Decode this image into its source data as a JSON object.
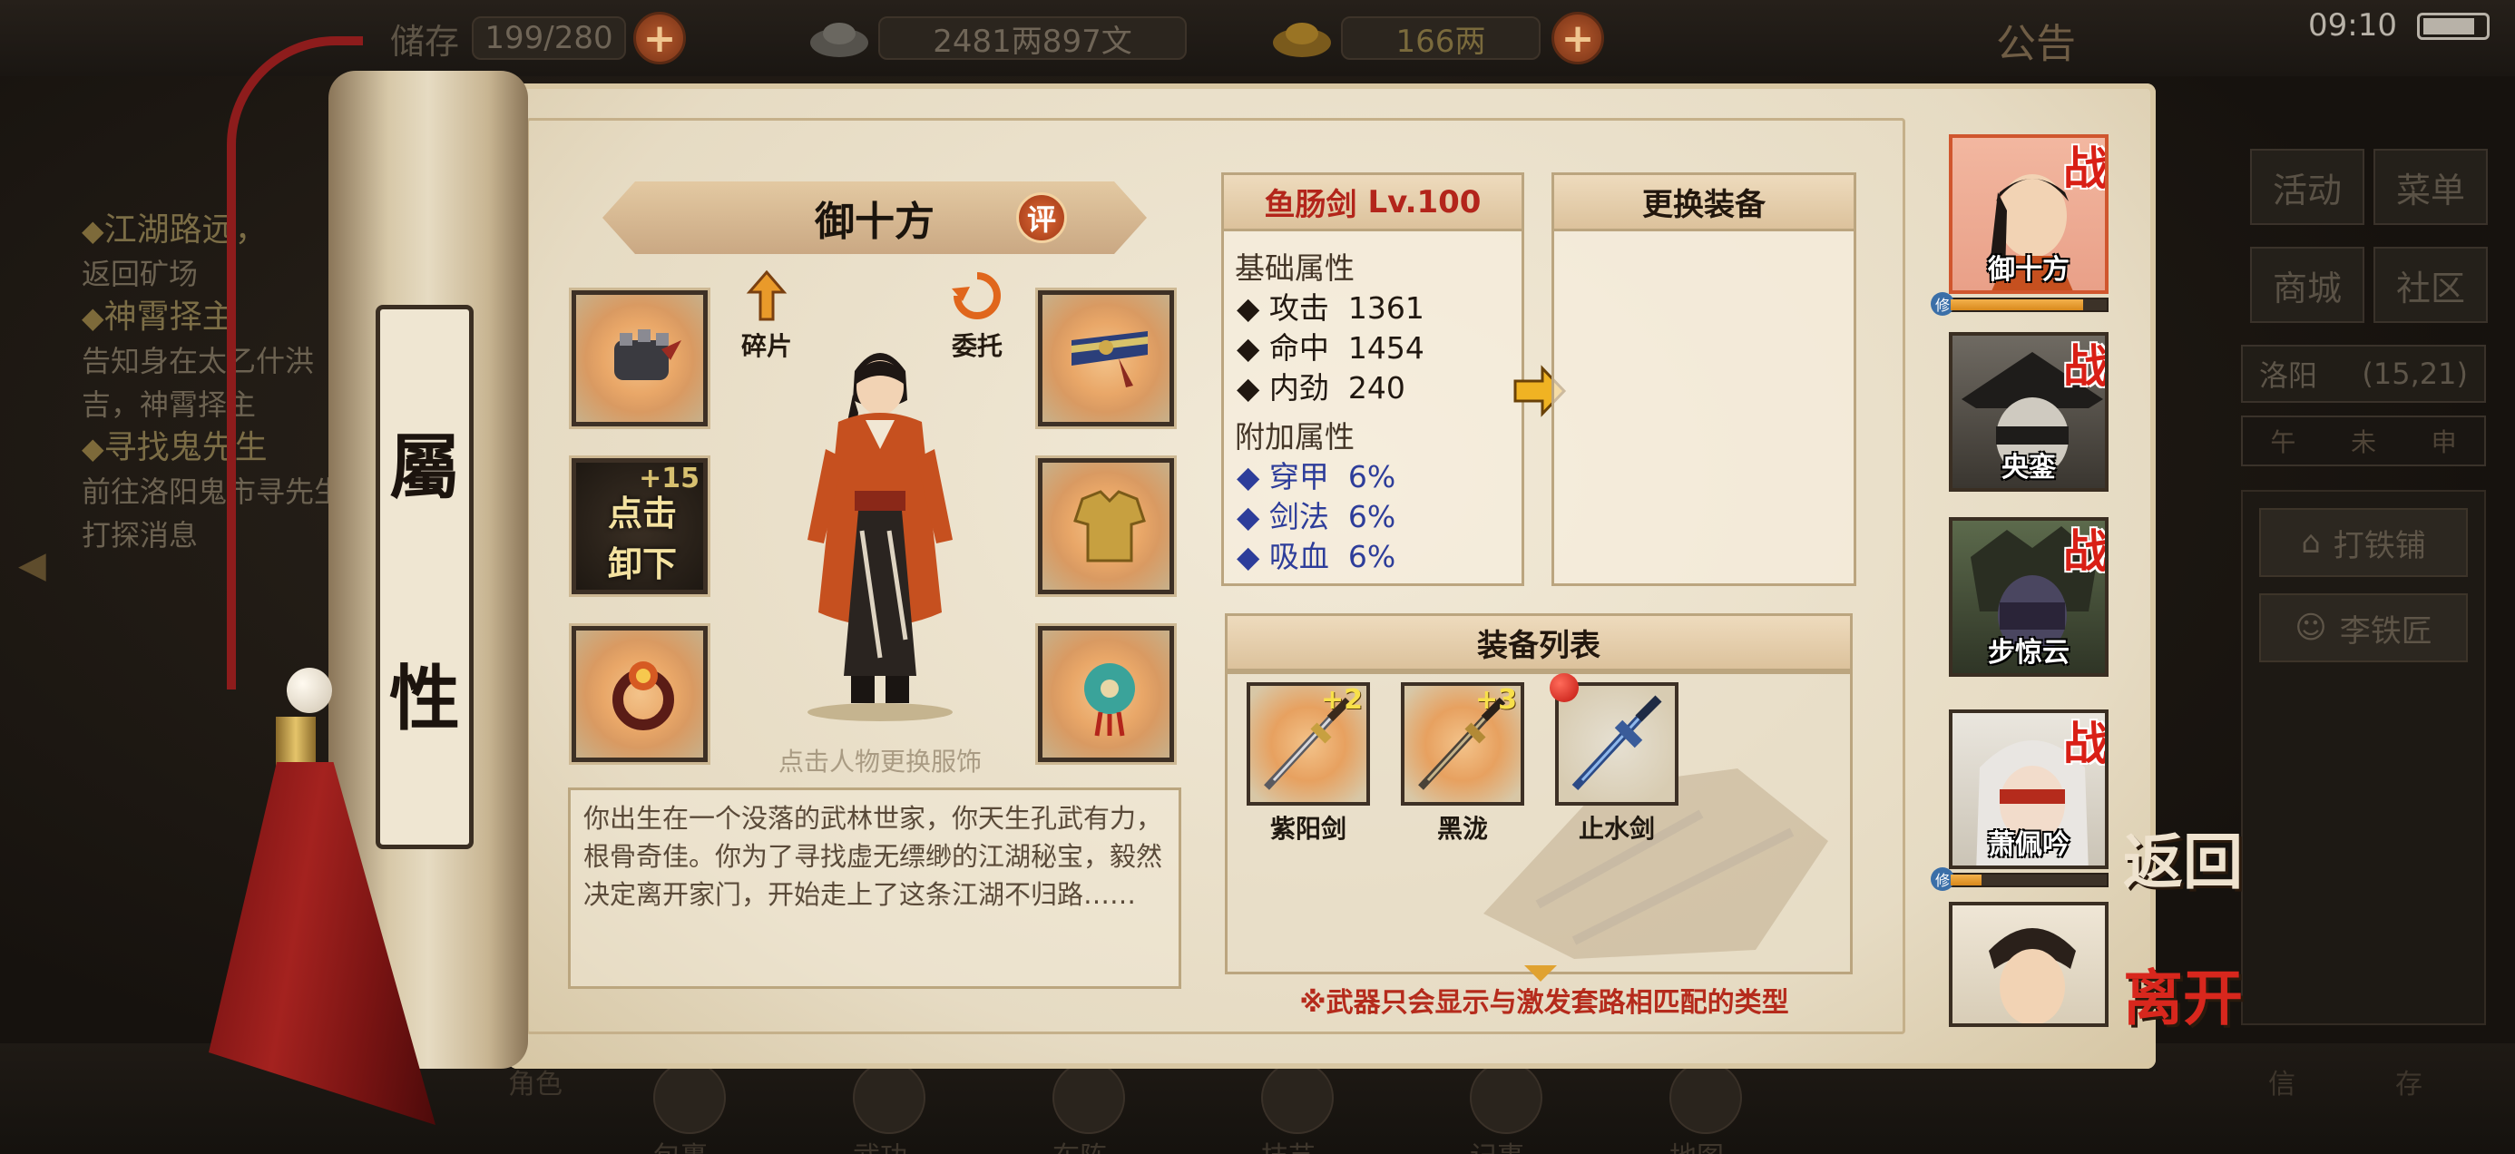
{
  "topbar": {
    "inventory_label": "储存",
    "inventory_value": "199/280",
    "silver_value": "2481两897文",
    "gold_value": "166两",
    "notice": "公告",
    "clock": "09:10"
  },
  "quests": [
    {
      "title": "江湖路远，",
      "desc": "返回矿场"
    },
    {
      "title": "神霄择主",
      "desc": "告知身在太乙什洪吉，神霄择主"
    },
    {
      "title": "寻找鬼先生",
      "desc": "前往洛阳鬼市寻先生打探消息"
    }
  ],
  "right_menu": {
    "activity": "活动",
    "menu": "菜单",
    "shop": "商城",
    "community": "社区",
    "location_name": "洛阳",
    "location_coords": "(15,21)",
    "compass_left": "午",
    "compass_mid": "未",
    "compass_right": "申",
    "smithy": "打铁铺",
    "smith_npc": "李铁匠",
    "letter": "信",
    "save": "存"
  },
  "bottom_nav": [
    "角色",
    "包裹",
    "武功",
    "布阵",
    "技艺",
    "记事",
    "地图"
  ],
  "scroll_title": [
    "屬",
    "性"
  ],
  "character": {
    "name": "御十方",
    "rate_badge": "评",
    "fragment_label": "碎片",
    "entrust_label": "委托",
    "unequip_label": "点击卸下",
    "unequip_plus": "+15",
    "outfit_hint": "点击人物更换服饰",
    "bio": "你出生在一个没落的武林世家，你天生孔武有力，根骨奇佳。你为了寻找虚无缥缈的江湖秘宝，毅然决定离开家门，开始走上了这条江湖不归路……"
  },
  "weapon": {
    "name": "鱼肠剑",
    "level": "Lv.100",
    "base_title": "基础属性",
    "base_stats": [
      {
        "name": "攻击",
        "value": "1361"
      },
      {
        "name": "命中",
        "value": "1454"
      },
      {
        "name": "内劲",
        "value": "240"
      }
    ],
    "extra_title": "附加属性",
    "extra_stats": [
      {
        "name": "穿甲",
        "value": "6%"
      },
      {
        "name": "剑法",
        "value": "6%"
      },
      {
        "name": "吸血",
        "value": "6%"
      }
    ]
  },
  "replace_title": "更换装备",
  "equip_list": {
    "title": "装备列表",
    "items": [
      {
        "name": "紫阳剑",
        "plus": "+2"
      },
      {
        "name": "黑泷",
        "plus": "+3"
      },
      {
        "name": "止水剑",
        "plus": ""
      }
    ],
    "footnote": "※武器只会显示与激发套路相匹配的类型"
  },
  "party": [
    {
      "name": "御十方",
      "fight": "战",
      "xp": 0.85
    },
    {
      "name": "央銮",
      "fight": "战"
    },
    {
      "name": "步惊云",
      "fight": "战"
    },
    {
      "name": "萧佩吟",
      "fight": "战",
      "xp": 0.2
    },
    {
      "name": "",
      "fight": ""
    }
  ],
  "back_label": "返回",
  "leave_label": "离开",
  "colors": {
    "paper": "#efe6d2",
    "accent_red": "#b3251b",
    "extra_stat_blue": "#2d3d9a",
    "tassel": "#a4221f"
  }
}
